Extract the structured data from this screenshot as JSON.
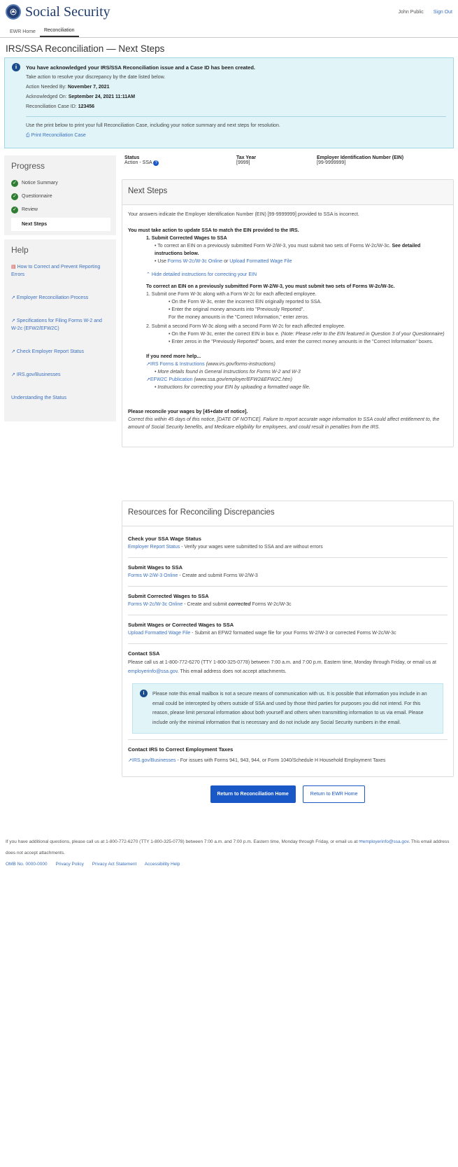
{
  "header": {
    "logo_text": "Social Security",
    "user": "John Public",
    "signout": "Sign Out"
  },
  "nav": {
    "tabs": [
      "EWR Home",
      "Reconciliation"
    ]
  },
  "page_title": "IRS/SSA Reconciliation — Next Steps",
  "alert": {
    "title": "You have acknowledged your IRS/SSA Reconciliation issue and a Case ID has been created.",
    "intro": "Take action to resolve your discrepancy by the date listed below.",
    "action_label": "Action Needed By:",
    "action_value": "November 7, 2021",
    "ack_label": "Acknowledged On:",
    "ack_value": "September 24, 2021 11:11AM",
    "case_label": "Reconciliation Case ID:",
    "case_value": "123456",
    "print_text": "Use the print below to print your full Reconciliation Case, including your notice summary and next steps for resolution.",
    "print_link": "Print Reconciliation Case"
  },
  "progress": {
    "heading": "Progress",
    "items": [
      "Notice Summary",
      "Questionnaire",
      "Review"
    ],
    "current": "Next Steps"
  },
  "help": {
    "heading": "Help",
    "items": [
      "How to Correct and Prevent Reporting Errors",
      "Employer Reconciliation Process",
      "Specifications for Filing Forms W-2 and W-2c (EFW2/EFW2C)",
      "Check Employer Report Status",
      "IRS.gov/Businesses",
      "Understanding the Status"
    ]
  },
  "status": {
    "status_label": "Status",
    "status_value": "Action - SSA",
    "tax_label": "Tax Year",
    "tax_value": "[9999]",
    "ein_label": "Employer Identification Number (EIN)",
    "ein_value": "[99-9999999]"
  },
  "next_steps": {
    "heading": "Next Steps",
    "intro": "Your answers indicate the Employer Identification Number (EIN) [99-9999999] provided to SSA is incorrect.",
    "must_take": "You must take action to update SSA to match the EIN provided to the IRS.",
    "step1": "1.  Submit Corrected Wages to SSA",
    "b1_pre": "• To correct an EIN on a previously submitted Form W-2/W-3, you must submit two sets of Forms W-2c/W-3c.",
    "b1_bold": "See detailed instructions below.",
    "b2_pre": "• Use",
    "b2_link1": "Forms  W-2c/W-3c Online",
    "b2_or": "or",
    "b2_link2": "Upload Formatted Wage File",
    "hide_link": "Hide detailed instructions for correcting your EIN",
    "detail_head": "To correct an EIN on a previously submitted Form W-2/W-3, you must submit two sets of Forms W-2c/W-3c.",
    "d1": "1.     Submit one Form W-3c along with a Form W-2c for each affected employee.",
    "d1a": "• On the Form W-3c, enter the incorrect EIN originally reported to SSA.",
    "d1b": "• Enter the original money amounts into \"Previously Reported\".",
    "d1c": "For the money amounts in the \"Correct Information,\" enter zeros.",
    "d2": "2.     Submit a second Form W-3c along with a second Form W-2c for each affected employee.",
    "d2a": "• On the Form W-3c, enter the correct EIN in box e.",
    "d2a_note": "(Note: Please refer to the  EIN featured in Question 3 of your Questionnaire)",
    "d2b": "• Enter zeros in the \"Previously Reported\" boxes, and enter the correct money amounts in the \"Correct Information\" boxes.",
    "more_help": "If you need more help...",
    "mh1": "IRS Forms & Instructions",
    "mh1_url": "(www.irs.gov/forms-instructions)",
    "mh1_sub": "More details found in General Instructions for Forms W-2 and W-3",
    "mh2": "EFW2C Publication",
    "mh2_url": "(www.ssa.gov/employer/EFW2&EFW2C.htm)",
    "mh2_sub": "Instructions for correcting your EIN by uploading a formatted wage file.",
    "reconcile_bold": "Please reconcile your wages by [45+date of notice].",
    "reconcile_ital": "Correct this within 45 days of this notice, [DATE OF NOTICE]. Failure to report accurate wage information to SSA could affect entitlement to, the amount of Social Security benefits, and Medicare eligibility for employees, and could result in penalties from the IRS."
  },
  "resources": {
    "heading": "Resources for Reconciling Discrepancies",
    "r1_h": "Check your SSA Wage Status",
    "r1_link": "Employer Report Status",
    "r1_text": " - Verify your wages were submitted to SSA and are without errors",
    "r2_h": "Submit Wages to SSA",
    "r2_link": "Forms  W-2/W-3 Online",
    "r2_text": " - Create and submit Forms W-2/W-3",
    "r3_h": "Submit Corrected Wages to SSA",
    "r3_link": "Forms  W-2c/W-3c Online",
    "r3_text_a": " - Create and submit ",
    "r3_text_b": "corrected",
    "r3_text_c": " Forms W-2c/W-3c",
    "r4_h": "Submit Wages or Corrected Wages to SSA",
    "r4_link": "Upload Formatted Wage File",
    "r4_text": " - Submit an EFW2 formatted wage file for your Forms W-2/W-3 or corrected Forms W-2c/W-3c",
    "r5_h": "Contact SSA",
    "r5_text_a": "Please call us at 1-800-772-6270 (TTY 1-800-325-0778) between 7:00 a.m. and 7:00 p.m. Eastern time, Monday through Friday, or email us at ",
    "r5_link": "employerinfo@ssa.gov",
    "r5_text_b": ". This email address does not accept attachments.",
    "note": "Please note this email mailbox is not a secure means of communication with us. It is possible that information you include in an email could be intercepted by others outside of SSA and used by those third parties for purposes you did not intend. For this reason, please limit personal information about both yourself and others when transmitting information to us via email.  Please include only the minimal information that is necessary and do not include any Social Security numbers in the email.",
    "r6_h": "Contact IRS to Correct Employment Taxes",
    "r6_link": "IRS.gov/Businesses",
    "r6_text": " - For issues with Forms 941, 943, 944, or Form 1040/Schedule H Household Employment Taxes"
  },
  "buttons": {
    "primary": "Return to Reconciliation Home",
    "secondary": "Return to EWR Home"
  },
  "footer": {
    "text_a": "If you have additional questions, please call us at 1-800-772-6270 (TTY 1-800-325-0778) between 7:00 a.m. and 7:00 p.m. Eastern time, Monday through Friday, or email us at ",
    "email": "employerinfo@ssa.gov",
    "text_b": ". This email address does not accept attachments.",
    "omb": "OMB No. 0000-0000",
    "links": [
      "Privacy Policy",
      "Privacy Act Statement",
      "Accessibility Help"
    ]
  }
}
